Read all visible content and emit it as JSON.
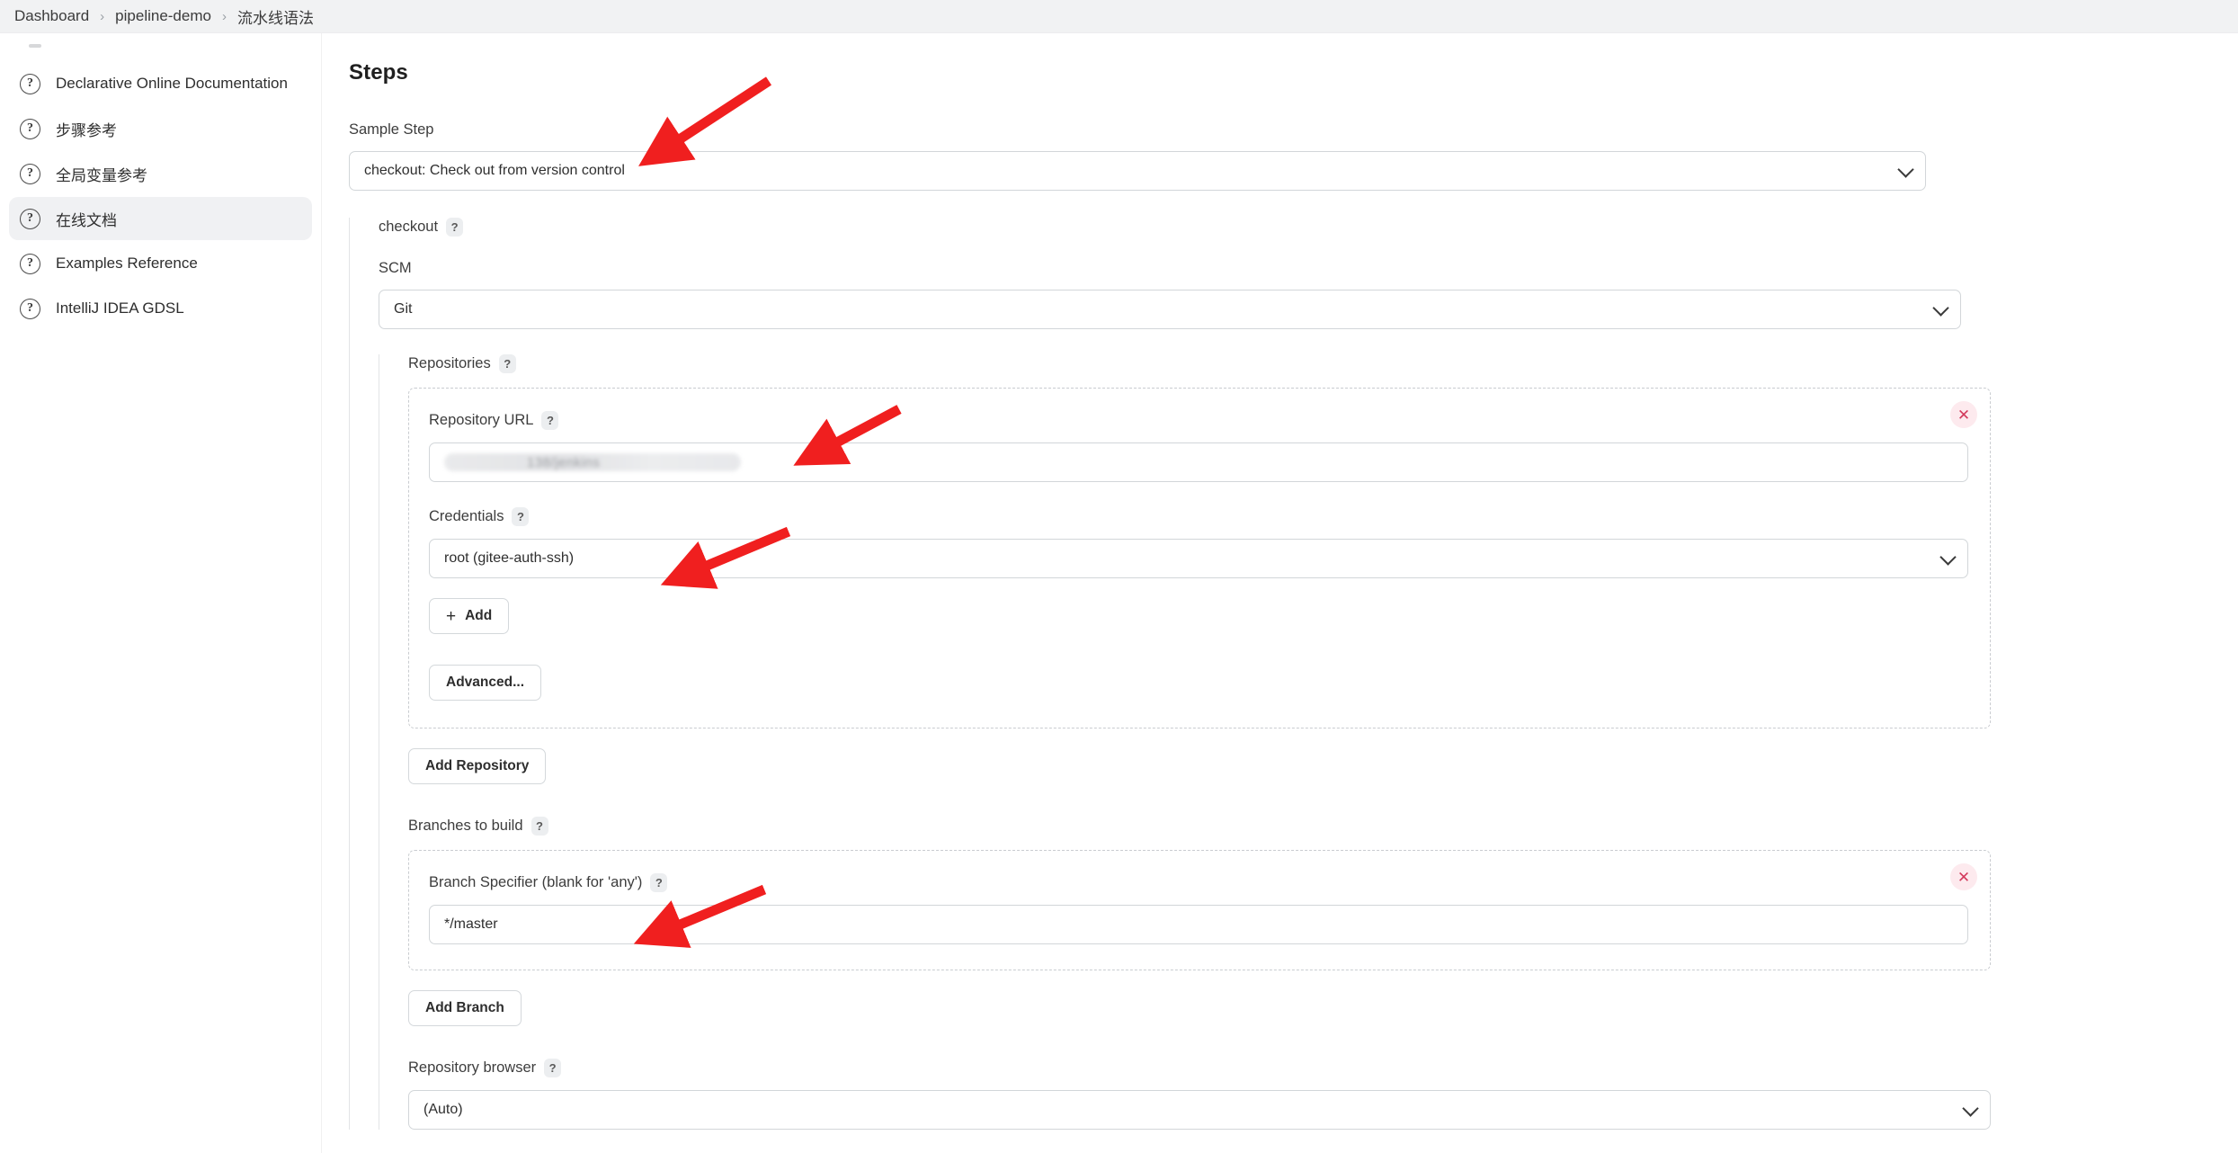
{
  "breadcrumb": {
    "items": [
      {
        "label": "Dashboard"
      },
      {
        "label": "pipeline-demo"
      },
      {
        "label": "流水线语法"
      }
    ],
    "separator": "›"
  },
  "sidebar": {
    "items": [
      {
        "label": "Declarative Online Documentation",
        "icon": "help-circle-icon",
        "active": false
      },
      {
        "label": "步骤参考",
        "icon": "help-circle-icon",
        "active": false
      },
      {
        "label": "全局变量参考",
        "icon": "help-circle-icon",
        "active": false
      },
      {
        "label": "在线文档",
        "icon": "help-circle-icon",
        "active": true
      },
      {
        "label": "Examples Reference",
        "icon": "help-circle-icon",
        "active": false
      },
      {
        "label": "IntelliJ IDEA GDSL",
        "icon": "help-circle-icon",
        "active": false
      }
    ],
    "icon_glyph": "?"
  },
  "main": {
    "page_title": "Steps",
    "sample_step": {
      "label": "Sample Step",
      "value": "checkout: Check out from version control",
      "icon": "chevron-down-icon"
    },
    "checkout": {
      "label": "checkout",
      "help": "?",
      "scm": {
        "label": "SCM",
        "value": "Git",
        "icon": "chevron-down-icon"
      },
      "repositories": {
        "label": "Repositories",
        "help": "?",
        "repository_url": {
          "label": "Repository URL",
          "help": "?",
          "value": "138/jenkins",
          "redacted": true
        },
        "credentials": {
          "label": "Credentials",
          "help": "?",
          "value": "root (gitee-auth-ssh)",
          "icon": "chevron-down-icon"
        },
        "add_button": "Add",
        "add_icon": "plus-icon",
        "advanced_button": "Advanced...",
        "delete_icon": "close-icon",
        "add_repository_button": "Add Repository"
      },
      "branches": {
        "label": "Branches to build",
        "help": "?",
        "branch_specifier": {
          "label": "Branch Specifier (blank for 'any')",
          "help": "?",
          "value": "*/master"
        },
        "delete_icon": "close-icon",
        "add_branch_button": "Add Branch"
      },
      "repository_browser": {
        "label": "Repository browser",
        "help": "?",
        "value": "(Auto)",
        "icon": "chevron-down-icon"
      }
    }
  },
  "annotations": {
    "color": "#f01f1f",
    "arrows": [
      {
        "target": "sample-step-select"
      },
      {
        "target": "repository-url-input"
      },
      {
        "target": "credentials-select"
      },
      {
        "target": "branch-specifier-input"
      }
    ]
  },
  "colors": {
    "breadcrumb_bg": "#f1f2f3",
    "active_sidebar_bg": "#f0f1f3",
    "input_border": "#d2d6d9",
    "dashed_border": "#c9ccd0",
    "delete_bg": "#fdeaee",
    "delete_fg": "#d33a5c",
    "annotation_red": "#f01f1f"
  }
}
